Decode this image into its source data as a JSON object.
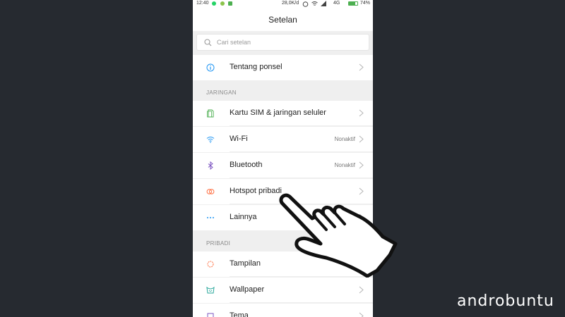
{
  "status_bar": {
    "time": "12:40",
    "speed": "28,0K/d",
    "network": "4G",
    "battery": "74%",
    "battery_fraction": 0.74
  },
  "header": {
    "title": "Setelan"
  },
  "search": {
    "placeholder": "Cari setelan"
  },
  "about": {
    "label": "Tentang ponsel"
  },
  "sections": {
    "network": "JARINGAN",
    "personal": "PRIBADI"
  },
  "network_items": [
    {
      "label": "Kartu SIM & jaringan seluler",
      "value": ""
    },
    {
      "label": "Wi-Fi",
      "value": "Nonaktif"
    },
    {
      "label": "Bluetooth",
      "value": "Nonaktif"
    },
    {
      "label": "Hotspot pribadi",
      "value": ""
    },
    {
      "label": "Lainnya",
      "value": ""
    }
  ],
  "personal_items": [
    {
      "label": "Tampilan"
    },
    {
      "label": "Wallpaper"
    },
    {
      "label": "Tema"
    }
  ],
  "watermark": "androbuntu",
  "colors": {
    "background": "#262a30",
    "accent_blue": "#2196f3",
    "battery": "#4caf50"
  }
}
